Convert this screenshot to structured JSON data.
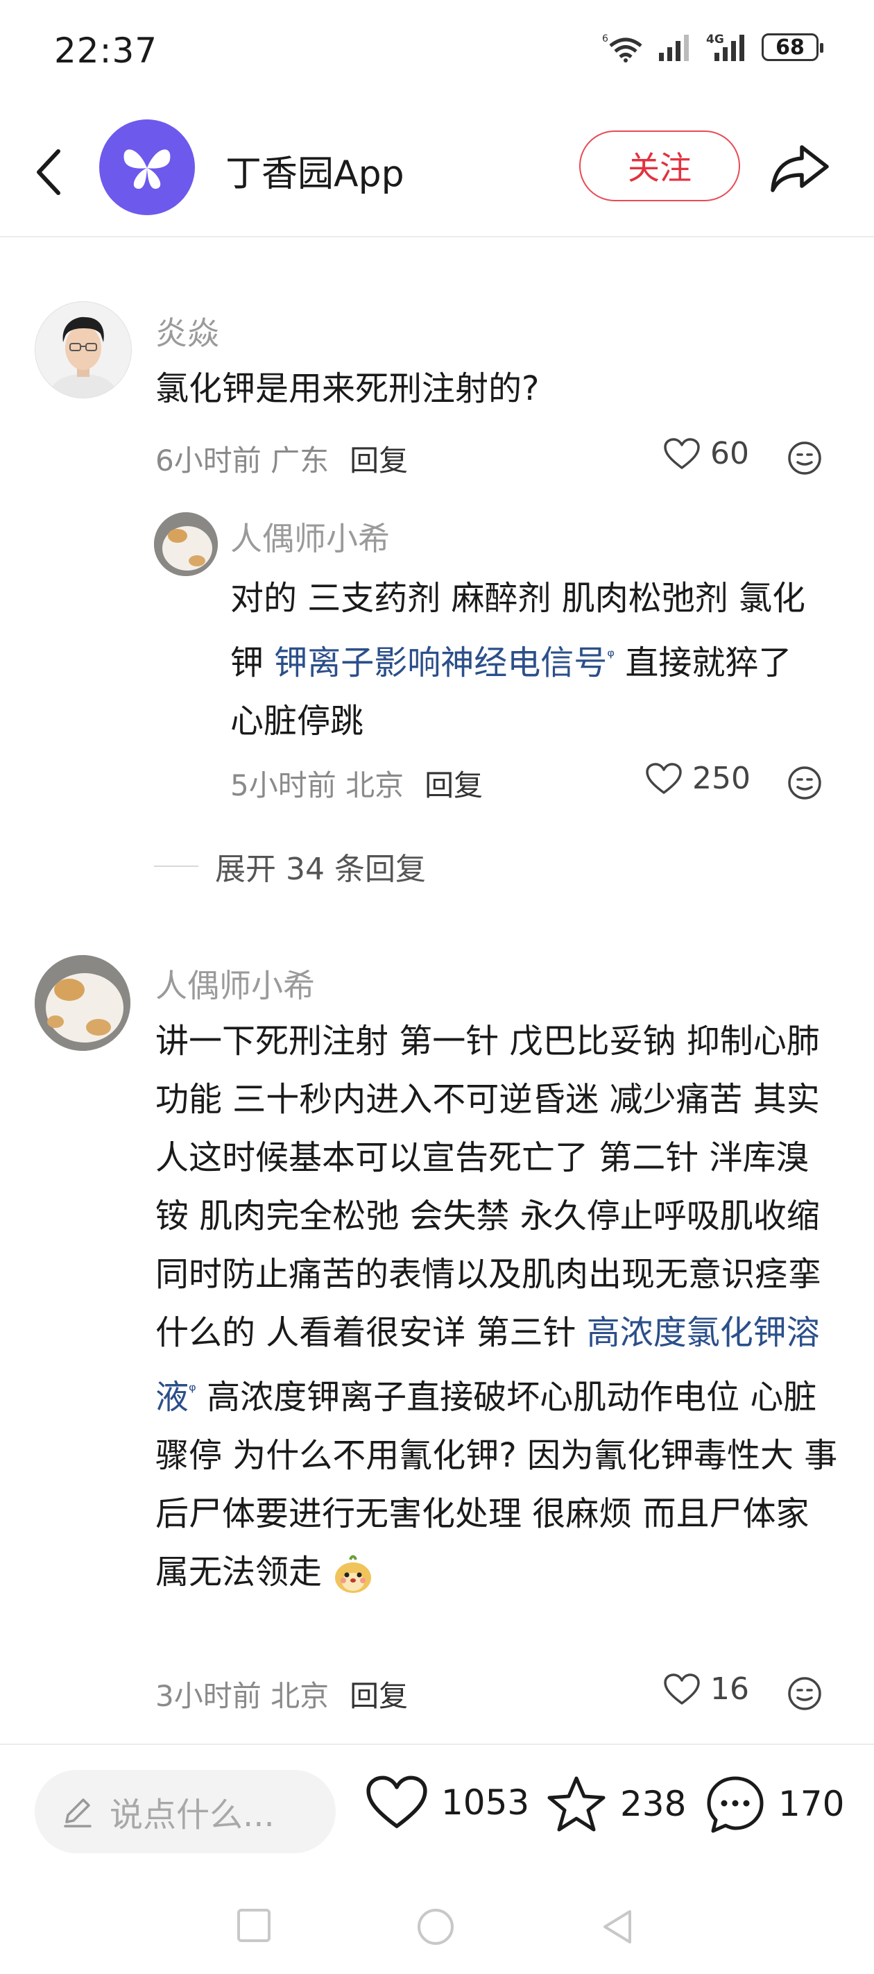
{
  "status_bar": {
    "time": "22:37",
    "battery": "68",
    "net1": "6",
    "net2": "4G"
  },
  "header": {
    "app_name": "丁香园App",
    "follow_label": "关注"
  },
  "comments": [
    {
      "author": "炎焱",
      "text": "氯化钾是用来死刑注射的?",
      "time_location": "6小时前 广东",
      "reply_label": "回复",
      "likes": "60",
      "replies": [
        {
          "author": "人偶师小希",
          "text_part1": "对的 三支药剂 麻醉剂 肌肉松弛剂 氯化钾 ",
          "link": "钾离子影响神经电信号",
          "text_part2": " 直接就猝了 心脏停跳",
          "time_location": "5小时前 北京",
          "reply_label": "回复",
          "likes": "250"
        }
      ],
      "expand_label": "展开 34 条回复"
    },
    {
      "author": "人偶师小希",
      "text_part1": "讲一下死刑注射 第一针 戊巴比妥钠 抑制心肺功能 三十秒内进入不可逆昏迷 减少痛苦 其实人这时候基本可以宣告死亡了 第二针 泮库溴铵 肌肉完全松弛 会失禁 永久停止呼吸肌收缩 同时防止痛苦的表情以及肌肉出现无意识痉挛什么的 人看着很安详 第三针 ",
      "link": "高浓度氯化钾溶液",
      "text_part2": " 高浓度钾离子直接破坏心肌动作电位 心脏骤停 为什么不用氰化钾? 因为氰化钾毒性大 事后尸体要进行无害化处理 很麻烦 而且尸体家属无法领走",
      "time_location": "3小时前 北京",
      "reply_label": "回复",
      "likes": "16"
    }
  ],
  "bottom_bar": {
    "input_placeholder": "说点什么...",
    "likes": "1053",
    "favorites": "238",
    "comments": "170"
  },
  "colors": {
    "accent_red": "#e3313f",
    "brand_purple": "#6d59ec",
    "link_blue": "#2b4f8a"
  },
  "icons": [
    "back-icon",
    "butterfly-logo-icon",
    "share-icon",
    "heart-icon",
    "smile-icon",
    "star-icon",
    "chat-icon",
    "pencil-icon",
    "square-nav-icon",
    "circle-nav-icon",
    "triangle-nav-icon"
  ]
}
